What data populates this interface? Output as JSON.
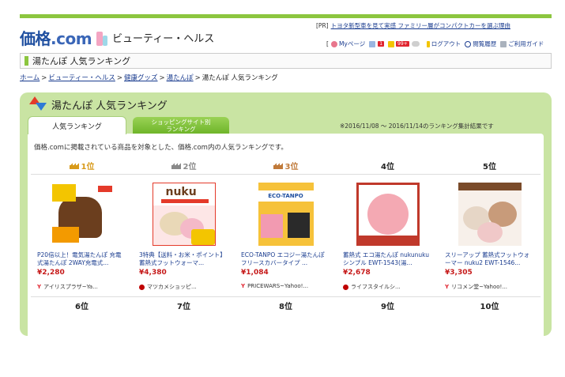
{
  "site": {
    "logo_main": "価格",
    "logo_suffix": ".com",
    "category": "ビューティー・ヘルス"
  },
  "pr": {
    "tag": "[PR]",
    "text": "トヨタ新型車を見て実感 ファミリー層がコンパクトカーを選ぶ理由"
  },
  "usernav": {
    "bracket": "[",
    "mypage": "Myページ",
    "mypage_badge": "1",
    "msg_badge": "99+",
    "logout": "ログアウト",
    "history": "閲覧履歴",
    "guide": "ご利用ガイド"
  },
  "page_title": "湯たんぽ 人気ランキング",
  "breadcrumb": {
    "items": [
      "ホーム",
      "ビューティー・ヘルス",
      "健康グッズ",
      "湯たんぽ"
    ],
    "current": "湯たんぽ 人気ランキング",
    "sep": ">"
  },
  "panel": {
    "title": "湯たんぽ 人気ランキング",
    "tab_active": "人気ランキング",
    "tab_other_line1": "ショッピングサイト別",
    "tab_other_line2": "ランキング",
    "period": "※2016/11/08 ～ 2016/11/14のランキング集計結果です",
    "description": "価格.comに掲載されている商品を対象とした、価格.com内の人気ランキングです。"
  },
  "ranks_top": [
    "1位",
    "2位",
    "3位",
    "4位",
    "5位"
  ],
  "ranks_bottom": [
    "6位",
    "7位",
    "8位",
    "9位",
    "10位"
  ],
  "thumb_text": {
    "p2_logo": "nuku",
    "p3_header": "ECO-TANPO"
  },
  "products": [
    {
      "name": "P20倍以上！電気湯たんぽ 充電式湯たんぽ 2WAY充電式...",
      "price": "¥2,280",
      "shop": "アイリスプラザ~Ya...",
      "shop_icon": "yahoo"
    },
    {
      "name": "3特典【送料・お米・ポイント】蓄熱式フットウォーマ...",
      "price": "¥4,380",
      "shop": "マツカメショッピ...",
      "shop_icon": "rakuten"
    },
    {
      "name": "ECO-TANPO エコジー湯たんぽ フリースカバータイプ ...",
      "price": "¥1,084",
      "shop": "PRICEWARS~Yahoo!...",
      "shop_icon": "yahoo"
    },
    {
      "name": "蓄熱式 エコ湯たんぽ nukunuku シンプル EWT-1543(湯...",
      "price": "¥2,678",
      "shop": "ライフスタイルシ...",
      "shop_icon": "rakuten"
    },
    {
      "name": "スリーアップ 蓄熱式フットウォーマー nuku2 EWT-1546...",
      "price": "¥3,305",
      "shop": "リコメン堂~Yahoo!...",
      "shop_icon": "yahoo"
    }
  ],
  "colors": {
    "brand_green": "#8cc63f",
    "link_blue": "#1a3c8f",
    "price_red": "#c61a1a",
    "panel_green": "#c9e4a3"
  }
}
